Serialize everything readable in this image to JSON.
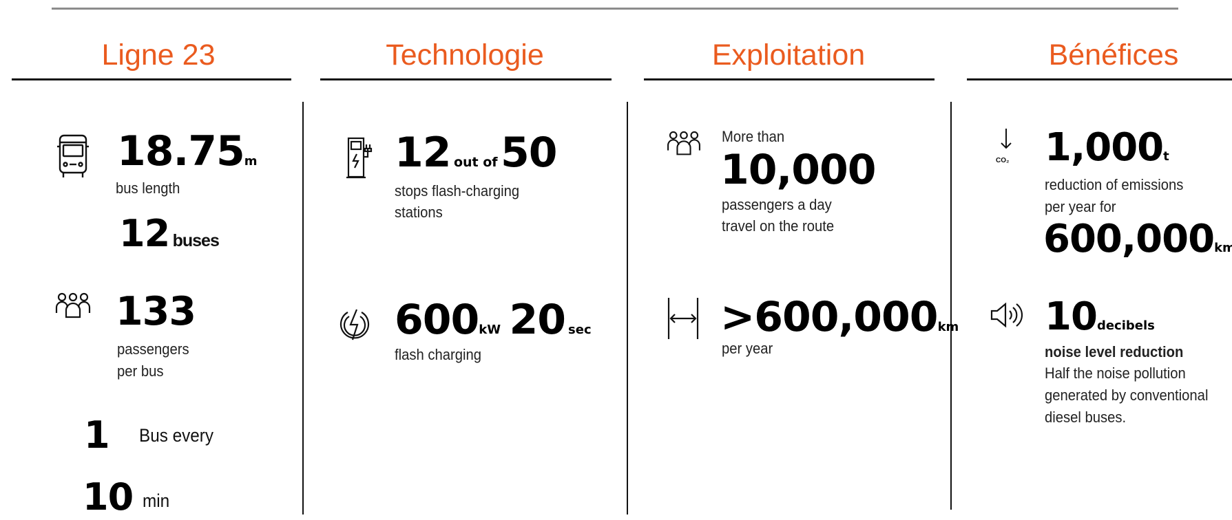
{
  "columns": [
    {
      "title": "Ligne 23"
    },
    {
      "title": "Technologie"
    },
    {
      "title": "Exploitation"
    },
    {
      "title": "Bénéfices"
    }
  ],
  "ligne": {
    "length_value": "18.75",
    "length_unit": "m",
    "length_label": "bus length",
    "buses_value": "12",
    "buses_label": "buses",
    "passengers_value": "133",
    "passengers_label_1": "passengers",
    "passengers_label_2": "per bus",
    "freq_value": "1",
    "freq_label": "Bus every",
    "interval_value": "10",
    "interval_label": "min"
  },
  "technologie": {
    "stops_value": "12",
    "stops_mid": "out of",
    "stops_total": "50",
    "stops_label_1": "stops flash-charging",
    "stops_label_2": "stations",
    "power_value": "600",
    "power_unit": "kW",
    "time_value": "20",
    "time_unit": "sec",
    "power_label": "flash charging"
  },
  "exploitation": {
    "pass_pre": "More than",
    "pass_value": "10,000",
    "pass_label_1": "passengers a day",
    "pass_label_2": "travel on the route",
    "km_value": ">600,000",
    "km_unit": "km",
    "km_label": "per year"
  },
  "benefices": {
    "co2_icon_label": "CO₂",
    "co2_value": "1,000",
    "co2_unit": "t",
    "co2_label_1": "reduction of emissions",
    "co2_label_2": "per year for",
    "co2_km_value": "600,000",
    "co2_km_unit": "km",
    "noise_value": "10",
    "noise_unit": "decibels",
    "noise_title": "noise level reduction",
    "noise_text_1": "Half the noise pollution",
    "noise_text_2": "generated by conventional",
    "noise_text_3": "diesel buses."
  }
}
